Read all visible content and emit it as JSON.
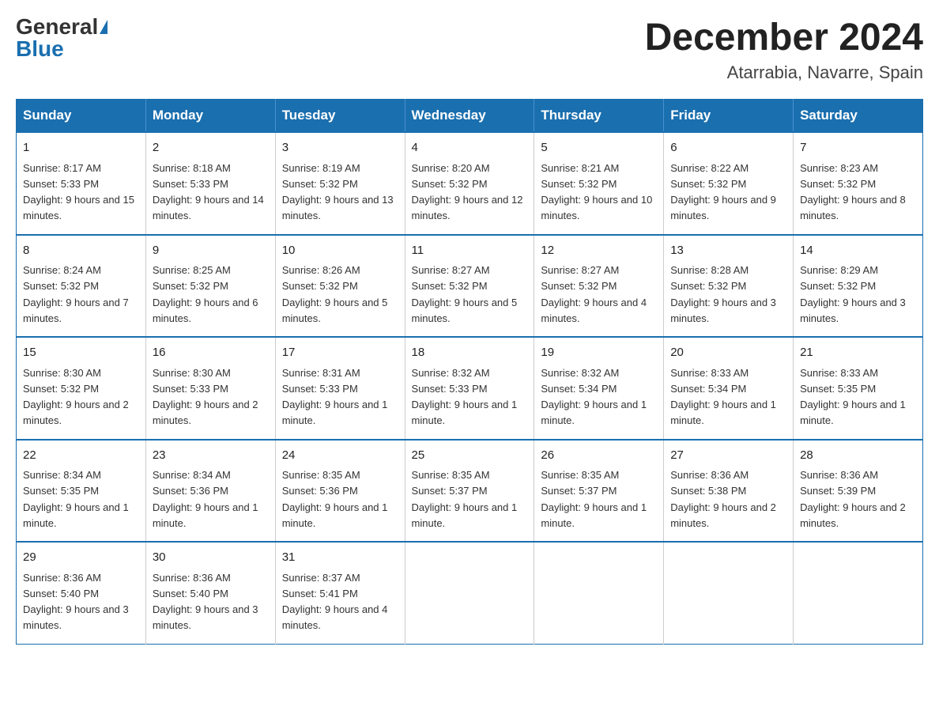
{
  "logo": {
    "general": "General",
    "blue": "Blue"
  },
  "title": {
    "month_year": "December 2024",
    "location": "Atarrabia, Navarre, Spain"
  },
  "headers": [
    "Sunday",
    "Monday",
    "Tuesday",
    "Wednesday",
    "Thursday",
    "Friday",
    "Saturday"
  ],
  "weeks": [
    [
      {
        "day": "1",
        "sunrise": "8:17 AM",
        "sunset": "5:33 PM",
        "daylight": "9 hours and 15 minutes."
      },
      {
        "day": "2",
        "sunrise": "8:18 AM",
        "sunset": "5:33 PM",
        "daylight": "9 hours and 14 minutes."
      },
      {
        "day": "3",
        "sunrise": "8:19 AM",
        "sunset": "5:32 PM",
        "daylight": "9 hours and 13 minutes."
      },
      {
        "day": "4",
        "sunrise": "8:20 AM",
        "sunset": "5:32 PM",
        "daylight": "9 hours and 12 minutes."
      },
      {
        "day": "5",
        "sunrise": "8:21 AM",
        "sunset": "5:32 PM",
        "daylight": "9 hours and 10 minutes."
      },
      {
        "day": "6",
        "sunrise": "8:22 AM",
        "sunset": "5:32 PM",
        "daylight": "9 hours and 9 minutes."
      },
      {
        "day": "7",
        "sunrise": "8:23 AM",
        "sunset": "5:32 PM",
        "daylight": "9 hours and 8 minutes."
      }
    ],
    [
      {
        "day": "8",
        "sunrise": "8:24 AM",
        "sunset": "5:32 PM",
        "daylight": "9 hours and 7 minutes."
      },
      {
        "day": "9",
        "sunrise": "8:25 AM",
        "sunset": "5:32 PM",
        "daylight": "9 hours and 6 minutes."
      },
      {
        "day": "10",
        "sunrise": "8:26 AM",
        "sunset": "5:32 PM",
        "daylight": "9 hours and 5 minutes."
      },
      {
        "day": "11",
        "sunrise": "8:27 AM",
        "sunset": "5:32 PM",
        "daylight": "9 hours and 5 minutes."
      },
      {
        "day": "12",
        "sunrise": "8:27 AM",
        "sunset": "5:32 PM",
        "daylight": "9 hours and 4 minutes."
      },
      {
        "day": "13",
        "sunrise": "8:28 AM",
        "sunset": "5:32 PM",
        "daylight": "9 hours and 3 minutes."
      },
      {
        "day": "14",
        "sunrise": "8:29 AM",
        "sunset": "5:32 PM",
        "daylight": "9 hours and 3 minutes."
      }
    ],
    [
      {
        "day": "15",
        "sunrise": "8:30 AM",
        "sunset": "5:32 PM",
        "daylight": "9 hours and 2 minutes."
      },
      {
        "day": "16",
        "sunrise": "8:30 AM",
        "sunset": "5:33 PM",
        "daylight": "9 hours and 2 minutes."
      },
      {
        "day": "17",
        "sunrise": "8:31 AM",
        "sunset": "5:33 PM",
        "daylight": "9 hours and 1 minute."
      },
      {
        "day": "18",
        "sunrise": "8:32 AM",
        "sunset": "5:33 PM",
        "daylight": "9 hours and 1 minute."
      },
      {
        "day": "19",
        "sunrise": "8:32 AM",
        "sunset": "5:34 PM",
        "daylight": "9 hours and 1 minute."
      },
      {
        "day": "20",
        "sunrise": "8:33 AM",
        "sunset": "5:34 PM",
        "daylight": "9 hours and 1 minute."
      },
      {
        "day": "21",
        "sunrise": "8:33 AM",
        "sunset": "5:35 PM",
        "daylight": "9 hours and 1 minute."
      }
    ],
    [
      {
        "day": "22",
        "sunrise": "8:34 AM",
        "sunset": "5:35 PM",
        "daylight": "9 hours and 1 minute."
      },
      {
        "day": "23",
        "sunrise": "8:34 AM",
        "sunset": "5:36 PM",
        "daylight": "9 hours and 1 minute."
      },
      {
        "day": "24",
        "sunrise": "8:35 AM",
        "sunset": "5:36 PM",
        "daylight": "9 hours and 1 minute."
      },
      {
        "day": "25",
        "sunrise": "8:35 AM",
        "sunset": "5:37 PM",
        "daylight": "9 hours and 1 minute."
      },
      {
        "day": "26",
        "sunrise": "8:35 AM",
        "sunset": "5:37 PM",
        "daylight": "9 hours and 1 minute."
      },
      {
        "day": "27",
        "sunrise": "8:36 AM",
        "sunset": "5:38 PM",
        "daylight": "9 hours and 2 minutes."
      },
      {
        "day": "28",
        "sunrise": "8:36 AM",
        "sunset": "5:39 PM",
        "daylight": "9 hours and 2 minutes."
      }
    ],
    [
      {
        "day": "29",
        "sunrise": "8:36 AM",
        "sunset": "5:40 PM",
        "daylight": "9 hours and 3 minutes."
      },
      {
        "day": "30",
        "sunrise": "8:36 AM",
        "sunset": "5:40 PM",
        "daylight": "9 hours and 3 minutes."
      },
      {
        "day": "31",
        "sunrise": "8:37 AM",
        "sunset": "5:41 PM",
        "daylight": "9 hours and 4 minutes."
      },
      null,
      null,
      null,
      null
    ]
  ]
}
